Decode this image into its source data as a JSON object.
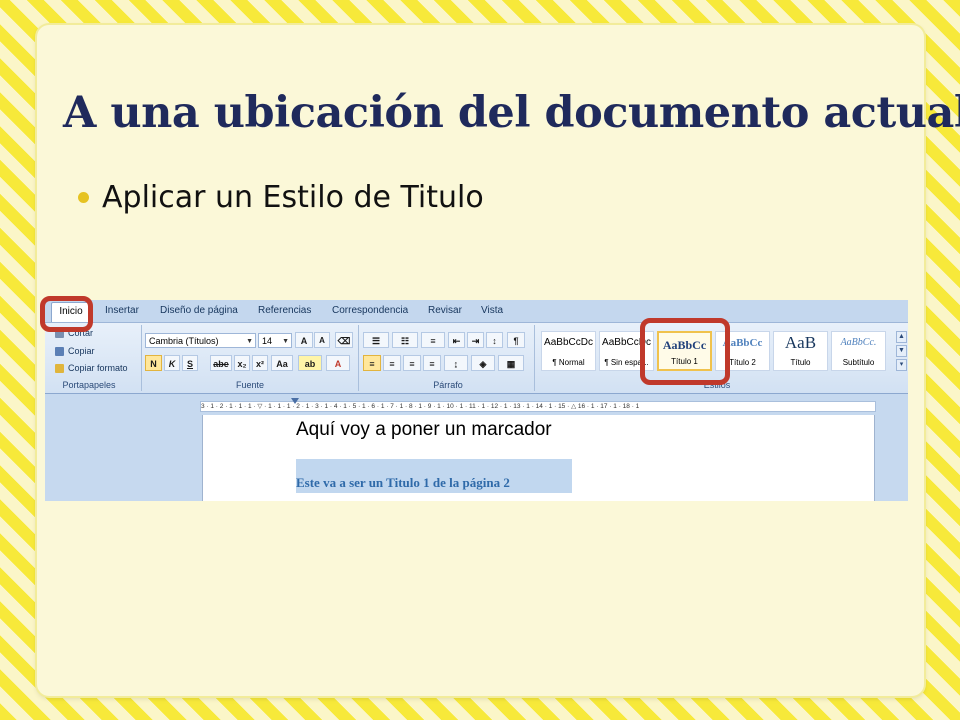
{
  "slide": {
    "title": "A una ubicación del documento actual",
    "bullet": "Aplicar un Estilo de Titulo"
  },
  "word": {
    "tabs": [
      "Inicio",
      "Insertar",
      "Diseño de página",
      "Referencias",
      "Correspondencia",
      "Revisar",
      "Vista"
    ],
    "active_tab": "Inicio",
    "clipboard": {
      "items": [
        "Cortar",
        "Copiar",
        "Copiar formato"
      ],
      "label": "Portapapeles"
    },
    "font": {
      "family": "Cambria (Títulos)",
      "size": "14",
      "label": "Fuente",
      "grow": "A",
      "shrink": "A",
      "bold": "N",
      "italic": "K",
      "underline": "S",
      "strike": "abe",
      "subscript": "x₂",
      "superscript": "x²",
      "change_case": "Aa",
      "highlight": "ab",
      "color": "A"
    },
    "paragraph": {
      "label": "Párrafo",
      "pilcrow": "¶"
    },
    "styles": {
      "label": "Estilos",
      "items": [
        {
          "sample": "AaBbCcDc",
          "name": "¶ Normal"
        },
        {
          "sample": "AaBbCcDc",
          "name": "¶ Sin espa..."
        },
        {
          "sample": "AaBbCc",
          "name": "Título 1"
        },
        {
          "sample": "AaBbCc",
          "name": "Título 2"
        },
        {
          "sample": "AaB",
          "name": "Título"
        },
        {
          "sample": "AaBbCc.",
          "name": "Subtítulo"
        }
      ],
      "selected": "Título 1"
    },
    "ruler": "3 · 1 · 2 · 1 · 1 · 1 · ▽ · 1 · 1 · 1 · 2 · 1 · 3 · 1 · 4 · 1 · 5 · 1 · 6 · 1 · 7 · 1 · 8 · 1 · 9 · 1 · 10 · 1 · 11 · 1 · 12 · 1 · 13 · 1 · 14 · 1 · 15 · △ 16 · 1 · 17 · 1 · 18 · 1",
    "document": {
      "line1": "Aquí voy a poner un marcador",
      "line2": "Este va a ser un Titulo 1 de la página 2"
    },
    "colors": {
      "callout": "#c0392b",
      "title": "#1f2a5c",
      "bullet": "#e6c322",
      "heading_text": "#2f6aa9"
    }
  }
}
